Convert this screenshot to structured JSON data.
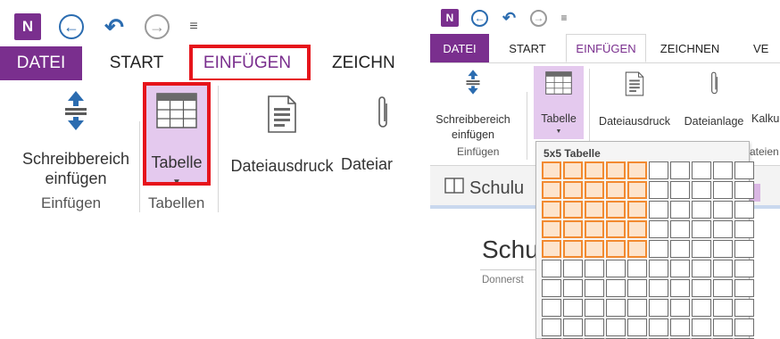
{
  "left": {
    "tabs": [
      "DATEI",
      "START",
      "EINFÜGEN",
      "ZEICHN"
    ],
    "buttons": {
      "writing_space": [
        "Schreibbereich",
        "einfügen"
      ],
      "table": "Tabelle",
      "printout": "Dateiausdruck",
      "attachment": "Dateiar"
    },
    "groups": {
      "insert": "Einfügen",
      "tables": "Tabellen"
    }
  },
  "right": {
    "tabs": [
      "DATEI",
      "START",
      "EINFÜGEN",
      "ZEICHNEN",
      "VE"
    ],
    "buttons": {
      "writing_space": [
        "Schreibbereich",
        "einfügen"
      ],
      "table": "Tabelle",
      "printout": "Dateiausdruck",
      "attachment": "Dateianlage",
      "calc": "Kalku"
    },
    "groups": {
      "insert": "Einfügen",
      "other": "ateien"
    },
    "section_tab": "Schulu",
    "page_title": "Schu",
    "page_date": "Donnerst",
    "picker": {
      "title": "5x5 Tabelle",
      "columns": 10,
      "rows": 10,
      "selected_columns": 5,
      "selected_rows": 5
    }
  },
  "colors": {
    "accent": "#7a2f8e",
    "highlight": "#e6141b",
    "selection": "#f28a30",
    "pressed": "#e4c9ee"
  },
  "icons": [
    "onenote-logo-icon",
    "back-icon",
    "undo-icon",
    "forward-icon",
    "customize-qat-icon",
    "writing-space-icon",
    "table-icon",
    "printout-icon",
    "paperclip-icon",
    "notebook-icon"
  ]
}
